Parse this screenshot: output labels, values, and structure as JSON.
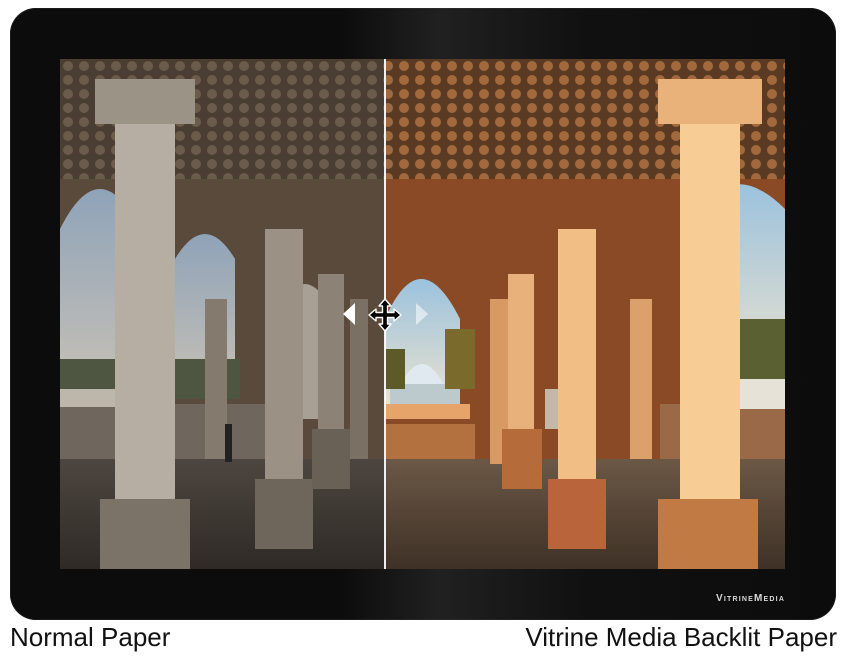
{
  "watermark": "VitrineMedia",
  "captions": {
    "left": "Normal Paper",
    "right": "Vitrine Media Backlit Paper"
  },
  "icons": {
    "slider_left": "triangle-left-icon",
    "slider_right": "triangle-right-icon",
    "cursor": "move-cursor-icon"
  },
  "colors": {
    "frame": "#0c0c0c",
    "normal_tone": "#8c7a66",
    "backlit_tone": "#c8773e",
    "divider": "#ffffff"
  }
}
